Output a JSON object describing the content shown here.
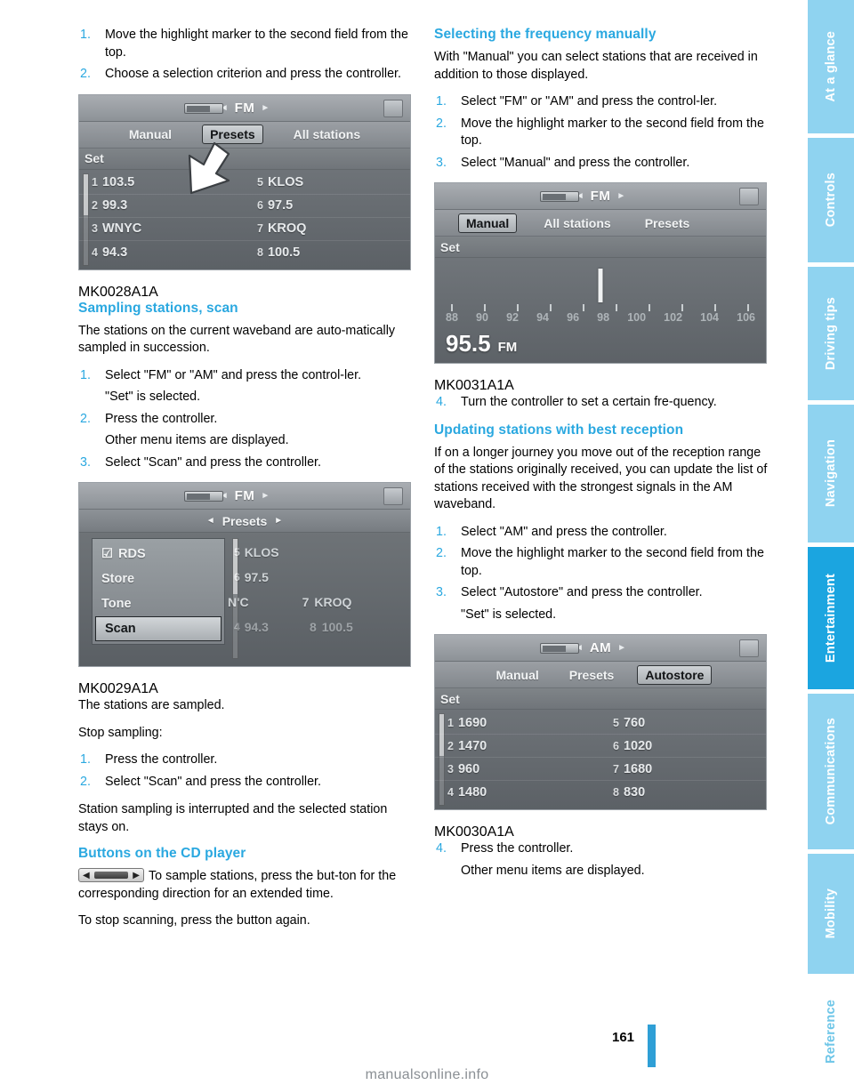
{
  "page": {
    "number": "161",
    "watermark": "manualsonline.info"
  },
  "rail": {
    "tabs": [
      {
        "label": "At a glance",
        "style": "lite"
      },
      {
        "label": "Controls",
        "style": "lite"
      },
      {
        "label": "Driving tips",
        "style": "lite"
      },
      {
        "label": "Navigation",
        "style": "lite"
      },
      {
        "label": "Entertainment",
        "style": "dark"
      },
      {
        "label": "Communications",
        "style": "lite"
      },
      {
        "label": "Mobility",
        "style": "lite"
      },
      {
        "label": "Reference",
        "style": "white"
      }
    ]
  },
  "left": {
    "intro_steps": [
      {
        "num": "1.",
        "text": "Move the highlight marker to the second field from the top."
      },
      {
        "num": "2.",
        "text": "Choose a selection criterion and press the controller."
      }
    ],
    "display1": {
      "band": "FM",
      "menu": [
        "Manual",
        "Presets",
        "All stations"
      ],
      "selected": "Presets",
      "set_label": "Set",
      "presets": [
        {
          "idx": "1",
          "name": "103.5"
        },
        {
          "idx": "5",
          "name": "KLOS"
        },
        {
          "idx": "2",
          "name": "99.3"
        },
        {
          "idx": "6",
          "name": "97.5"
        },
        {
          "idx": "3",
          "name": "WNYC"
        },
        {
          "idx": "7",
          "name": "KROQ"
        },
        {
          "idx": "4",
          "name": "94.3"
        },
        {
          "idx": "8",
          "name": "100.5"
        }
      ],
      "code": "MK0028A1A"
    },
    "scan": {
      "heading": "Sampling stations, scan",
      "intro": "The stations on the current waveband are auto-matically sampled in succession.",
      "steps": [
        {
          "num": "1.",
          "text": "Select \"FM\" or \"AM\" and press the control-ler."
        },
        {
          "num": "",
          "text": "\"Set\" is selected."
        },
        {
          "num": "2.",
          "text": "Press the controller."
        },
        {
          "num": "",
          "text": "Other menu items are displayed."
        },
        {
          "num": "3.",
          "text": "Select \"Scan\" and press the controller."
        }
      ]
    },
    "display2": {
      "band": "FM",
      "preset_bar": "Presets",
      "menu_items": [
        "RDS",
        "Store",
        "Tone",
        "Scan"
      ],
      "menu_selected": "Scan",
      "bg_rows": [
        {
          "idx": "5",
          "name": "KLOS"
        },
        {
          "idx": "6",
          "name": "97.5"
        },
        {
          "idx": "",
          "name": "N'C"
        },
        {
          "idx": "7",
          "name": "KROQ"
        },
        {
          "idx": "4",
          "name": "94.3"
        },
        {
          "idx": "8",
          "name": "100.5"
        }
      ],
      "code": "MK0029A1A"
    },
    "after_scan": [
      "The stations are sampled.",
      "Stop sampling:"
    ],
    "stop_steps": [
      {
        "num": "1.",
        "text": "Press the controller."
      },
      {
        "num": "2.",
        "text": "Select \"Scan\" and press the controller."
      }
    ],
    "after_stop": "Station sampling is interrupted and the selected station stays on.",
    "cd": {
      "heading": "Buttons on the CD player",
      "text1": "To sample stations, press the but-ton for the corresponding direction for an extended time.",
      "text2": "To stop scanning, press the button again."
    }
  },
  "right": {
    "manual": {
      "heading": "Selecting the frequency manually",
      "intro": "With \"Manual\" you can select stations that are received in addition to those displayed.",
      "steps": [
        {
          "num": "1.",
          "text": "Select \"FM\" or \"AM\" and press the control-ler."
        },
        {
          "num": "2.",
          "text": "Move the highlight marker to the second field from the top."
        },
        {
          "num": "3.",
          "text": "Select \"Manual\" and press the controller."
        }
      ],
      "display": {
        "band": "FM",
        "menu": [
          "Manual",
          "All stations",
          "Presets"
        ],
        "selected": "Manual",
        "set_label": "Set",
        "scale_numbers": [
          "88",
          "90",
          "92",
          "94",
          "96",
          "98",
          "100",
          "102",
          "104",
          "106"
        ],
        "frequency": "95.5",
        "unit": "FM",
        "code": "MK0031A1A"
      },
      "step4": {
        "num": "4.",
        "text": "Turn the controller to set a certain fre-quency."
      }
    },
    "updating": {
      "heading": "Updating stations with best reception",
      "intro": "If on a longer journey you move out of the reception range of the stations originally received, you can update the list of stations received with the strongest signals in the AM waveband.",
      "steps": [
        {
          "num": "1.",
          "text": "Select \"AM\" and press the controller."
        },
        {
          "num": "2.",
          "text": "Move the highlight marker to the second field from the top."
        },
        {
          "num": "3.",
          "text": "Select \"Autostore\" and press the controller."
        },
        {
          "num": "",
          "text": "\"Set\" is selected."
        }
      ],
      "display": {
        "band": "AM",
        "menu": [
          "Manual",
          "Presets",
          "Autostore"
        ],
        "selected": "Autostore",
        "set_label": "Set",
        "presets": [
          {
            "idx": "1",
            "name": "1690"
          },
          {
            "idx": "5",
            "name": "760"
          },
          {
            "idx": "2",
            "name": "1470"
          },
          {
            "idx": "6",
            "name": "1020"
          },
          {
            "idx": "3",
            "name": "960"
          },
          {
            "idx": "7",
            "name": "1680"
          },
          {
            "idx": "4",
            "name": "1480"
          },
          {
            "idx": "8",
            "name": "830"
          }
        ],
        "code": "MK0030A1A"
      },
      "step4": [
        {
          "num": "4.",
          "text": "Press the controller."
        },
        {
          "num": "",
          "text": "Other menu items are displayed."
        }
      ]
    }
  }
}
